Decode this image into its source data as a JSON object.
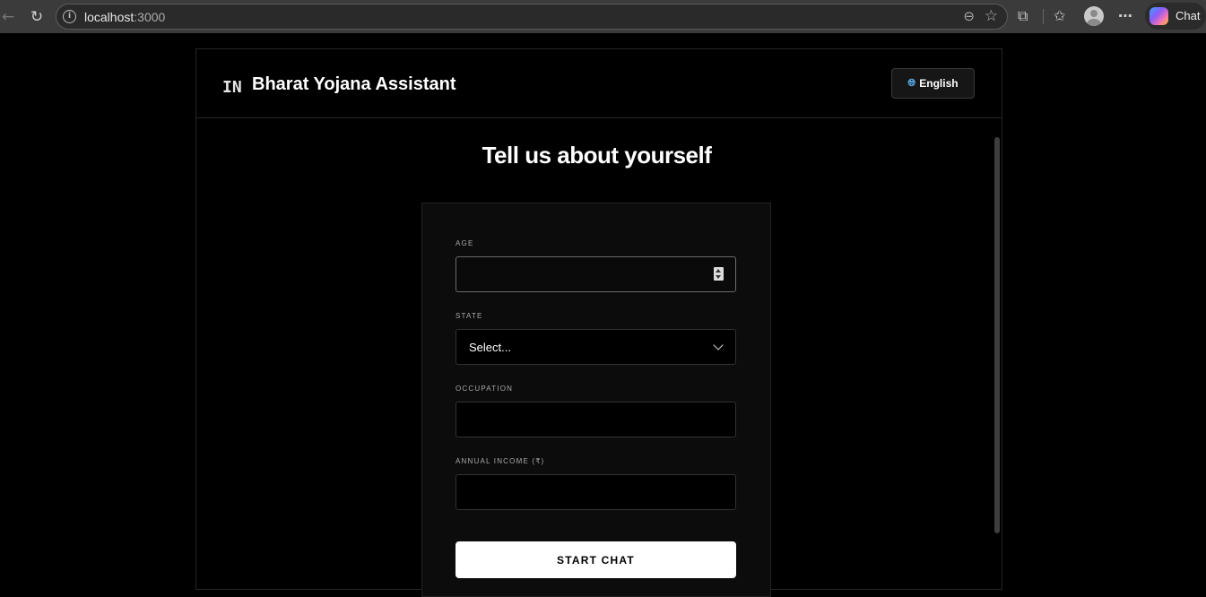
{
  "browser": {
    "url_host": "localhost",
    "url_port": ":3000",
    "copilot_label": "Chat",
    "icons": {
      "back": "back-arrow-icon",
      "reload": "reload-icon",
      "site_info": "info-icon",
      "zoom": "zoom-icon",
      "favorite": "star-icon",
      "extensions": "puzzle-icon",
      "favorites": "favorites-icon",
      "profile": "avatar",
      "more": "more-icon"
    }
  },
  "header": {
    "brand_code": "IN",
    "brand_name": "Bharat Yojana Assistant",
    "language_label": "English",
    "language_icon": "globe-icon"
  },
  "main": {
    "title": "Tell us about yourself",
    "form": {
      "age": {
        "label": "AGE",
        "value": ""
      },
      "state": {
        "label": "STATE",
        "value": "Select..."
      },
      "occupation": {
        "label": "OCCUPATION",
        "value": ""
      },
      "income": {
        "label": "ANNUAL INCOME (₹)",
        "value": ""
      },
      "submit_label": "START CHAT"
    }
  },
  "colors": {
    "background": "#000000",
    "card": "#0c0c0c",
    "accent_button": "#ffffff",
    "globe": "#5aa9e6"
  }
}
